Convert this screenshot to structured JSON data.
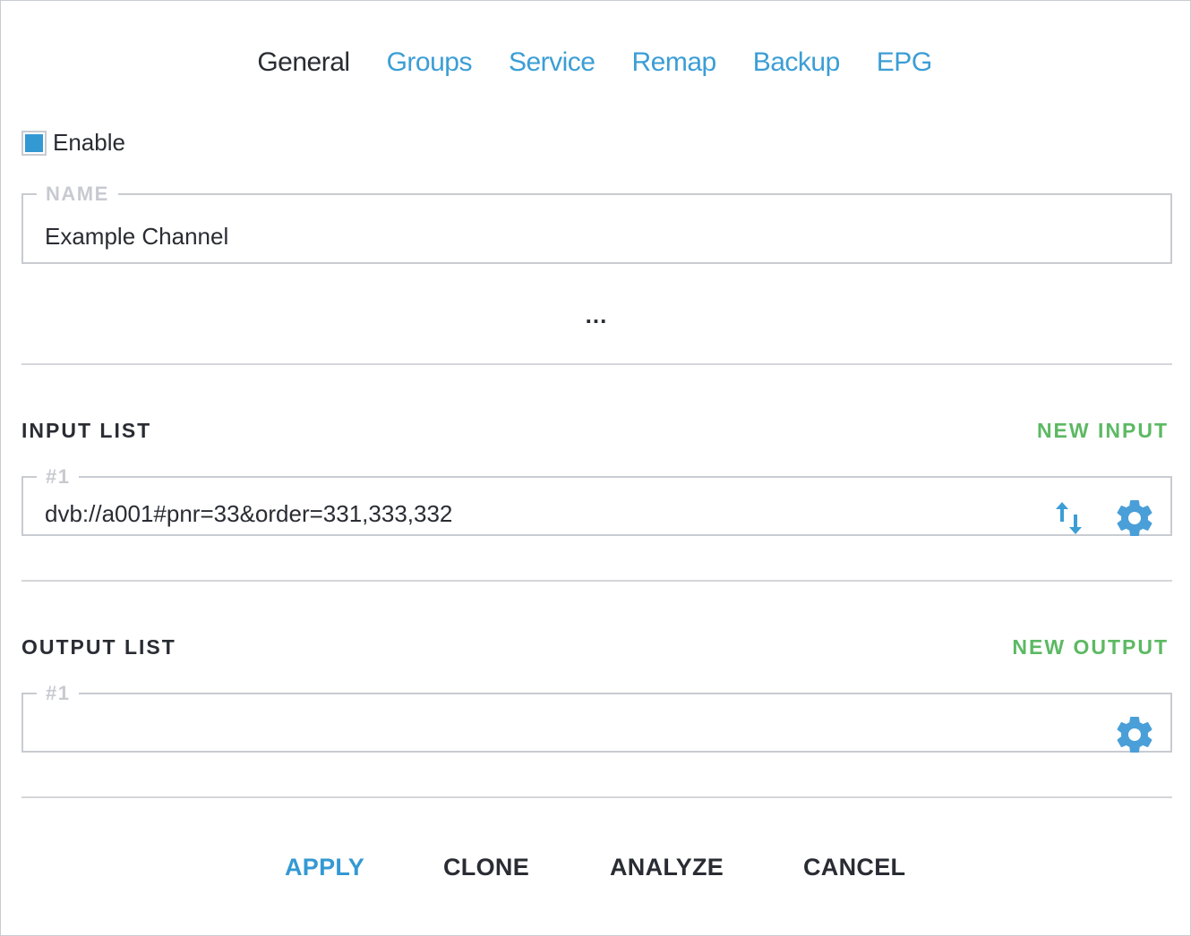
{
  "tabs": [
    {
      "label": "General",
      "active": true
    },
    {
      "label": "Groups",
      "active": false
    },
    {
      "label": "Service",
      "active": false
    },
    {
      "label": "Remap",
      "active": false
    },
    {
      "label": "Backup",
      "active": false
    },
    {
      "label": "EPG",
      "active": false
    }
  ],
  "enable": {
    "label": "Enable",
    "checked": true
  },
  "name_field": {
    "legend": "NAME",
    "value": "Example Channel"
  },
  "ellipsis": "...",
  "input_list": {
    "title": "INPUT LIST",
    "action": "NEW INPUT",
    "items": [
      {
        "legend": "#1",
        "value": "dvb://a001#pnr=33&order=331,333,332",
        "icons": [
          "swap-vertical-icon",
          "gear-icon"
        ]
      }
    ]
  },
  "output_list": {
    "title": "OUTPUT LIST",
    "action": "NEW OUTPUT",
    "items": [
      {
        "legend": "#1",
        "value": "",
        "icons": [
          "gear-icon"
        ]
      }
    ]
  },
  "footer": {
    "apply": "APPLY",
    "clone": "CLONE",
    "analyze": "ANALYZE",
    "cancel": "CANCEL"
  },
  "colors": {
    "accent": "#3399d3",
    "action_green": "#5cb963",
    "text": "#2a2c33",
    "border": "#c8cbd0"
  }
}
